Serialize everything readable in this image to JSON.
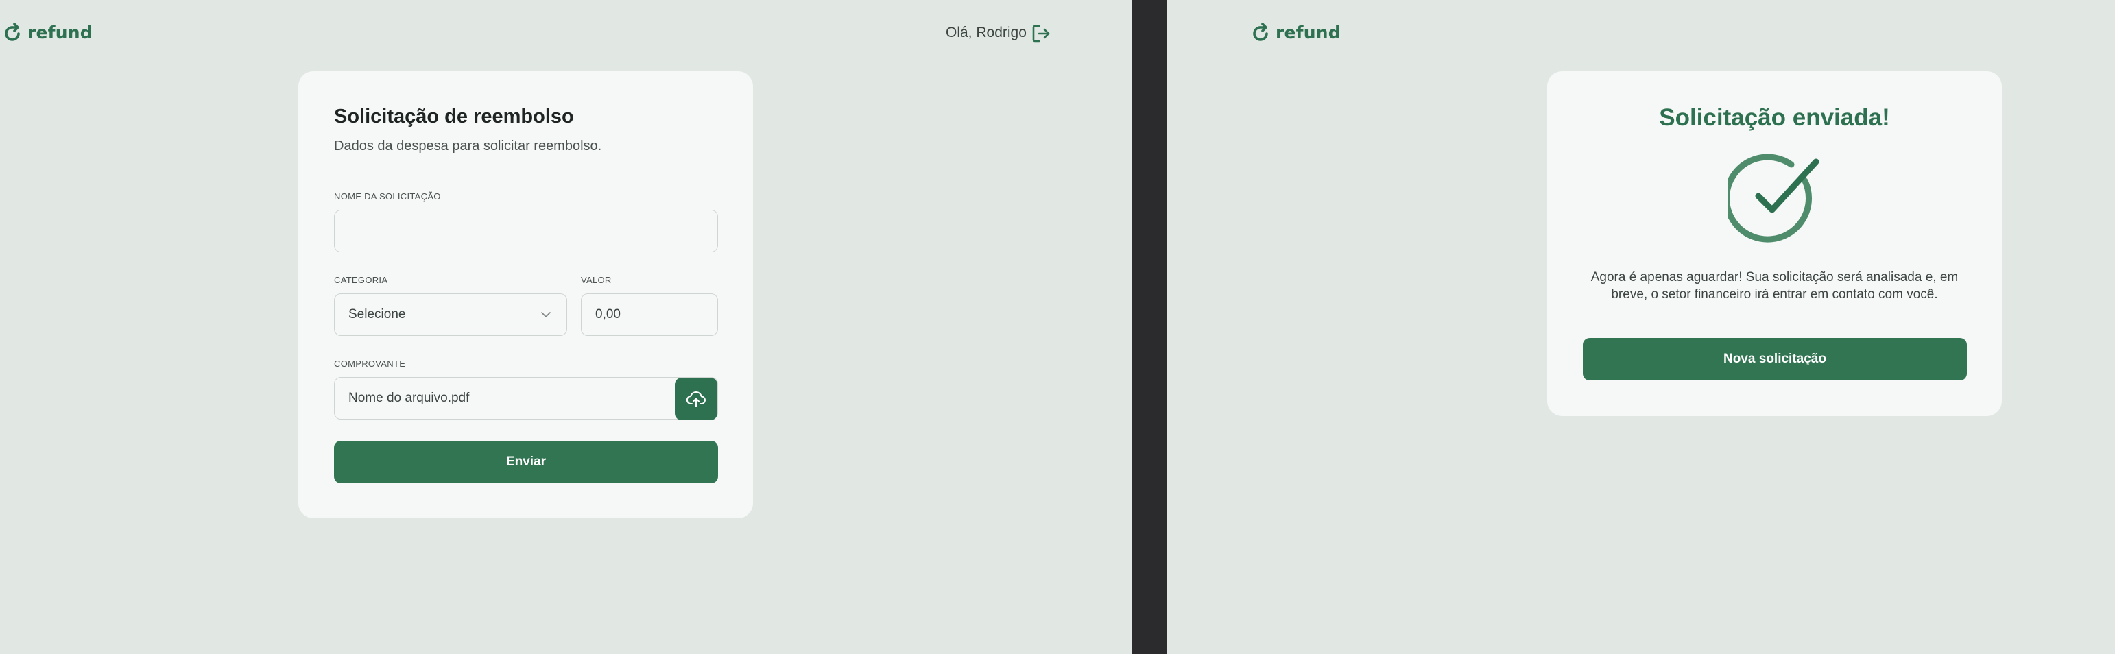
{
  "left": {
    "logo_text": "refund",
    "greeting": "Olá, Rodrigo",
    "form": {
      "title": "Solicitação de reembolso",
      "subtitle": "Dados da despesa para solicitar reembolso.",
      "name_label": "NOME DA SOLICITAÇÃO",
      "name_value": "",
      "category_label": "CATEGORIA",
      "category_value": "Selecione",
      "amount_label": "VALOR",
      "amount_value": "0,00",
      "receipt_label": "COMPROVANTE",
      "receipt_value": "Nome do arquivo.pdf",
      "submit_label": "Enviar"
    }
  },
  "right": {
    "logo_text": "refund",
    "success": {
      "title": "Solicitação enviada!",
      "message": "Agora é apenas aguardar! Sua solicitação será analisada e, em breve, o setor financeiro irá entrar em contato com você.",
      "button_label": "Nova solicitação"
    }
  },
  "colors": {
    "background": "#e1e8e4",
    "card": "#f6f8f7",
    "brand_green": "#2e7150",
    "divider": "#2b2b2e"
  },
  "icons": [
    "refund-logo-icon",
    "logout-icon",
    "chevron-down-icon",
    "cloud-upload-icon",
    "check-circle-icon"
  ]
}
